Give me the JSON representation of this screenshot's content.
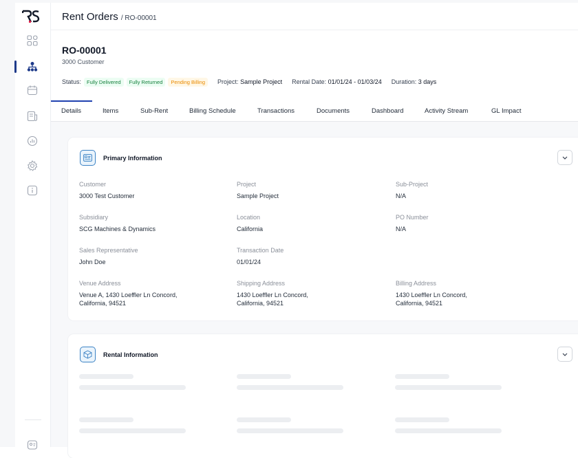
{
  "sidebar": {
    "logo": "RS",
    "items": [
      {
        "name": "dashboard-grid-icon"
      },
      {
        "name": "hierarchy-icon",
        "active": true
      },
      {
        "name": "calendar-icon"
      },
      {
        "name": "document-icon"
      },
      {
        "name": "chart-icon"
      },
      {
        "name": "settings-gear-icon"
      },
      {
        "name": "info-icon"
      }
    ],
    "bottom": {
      "name": "user-card-icon"
    }
  },
  "header": {
    "title": "Rent Orders",
    "breadcrumb": "/ RO-00001"
  },
  "order": {
    "id": "RO-00001",
    "customer": "3000 Customer",
    "status_label": "Status:",
    "badges": [
      "Fully Delivered",
      "Fully Returned",
      "Pending Billing"
    ],
    "project_label": "Project:",
    "project_value": "Sample Project",
    "rental_label": "Rental Date:",
    "rental_value": "01/01/24 - 01/03/24",
    "duration_label": "Duration:",
    "duration_value": "3 days"
  },
  "tabs": [
    "Details",
    "Items",
    "Sub-Rent",
    "Billing Schedule",
    "Transactions",
    "Documents",
    "Dashboard",
    "Activity Stream",
    "GL Impact"
  ],
  "primary": {
    "title": "Primary Information",
    "fields": [
      {
        "label": "Customer",
        "value": "3000 Test Customer"
      },
      {
        "label": "Project",
        "value": "Sample Project"
      },
      {
        "label": "Sub-Project",
        "value": "N/A"
      },
      {
        "label": "Subsidiary",
        "value": "SCG Machines & Dynamics"
      },
      {
        "label": "Location",
        "value": "California"
      },
      {
        "label": "PO Number",
        "value": "N/A"
      },
      {
        "label": "Sales Representative",
        "value": "John Doe"
      },
      {
        "label": "Transaction Date",
        "value": "01/01/24"
      },
      {
        "label": "Venue Address",
        "value_line1": "Venue A, 1430 Loeffler Ln Concord,",
        "value_line2": "California, 94521"
      },
      {
        "label": "Shipping Address",
        "value_line1": "1430 Loeffler Ln Concord,",
        "value_line2": "California, 94521"
      },
      {
        "label": "Billing Address",
        "value_line1": "1430 Loeffler Ln Concord,",
        "value_line2": "California, 94521"
      }
    ]
  },
  "rental": {
    "title": "Rental Information"
  },
  "colors": {
    "accent": "#1e40af",
    "badge_green": "#15803d",
    "badge_orange": "#ea8a00",
    "icon_blue": "#3b82c4"
  }
}
